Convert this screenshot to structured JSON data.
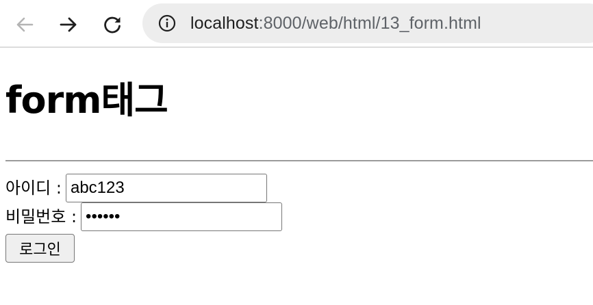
{
  "browser": {
    "url_host": "localhost",
    "url_path": ":8000/web/html/13_form.html",
    "icons": {
      "back": "back-arrow-icon",
      "forward": "forward-arrow-icon",
      "reload": "reload-icon",
      "site_info": "info-icon"
    }
  },
  "page": {
    "title": "form태그",
    "form": {
      "id_label": "아이디 :",
      "id_value": "abc123",
      "password_label": "비밀번호 :",
      "password_value": "123456",
      "submit_label": "로그인"
    }
  }
}
